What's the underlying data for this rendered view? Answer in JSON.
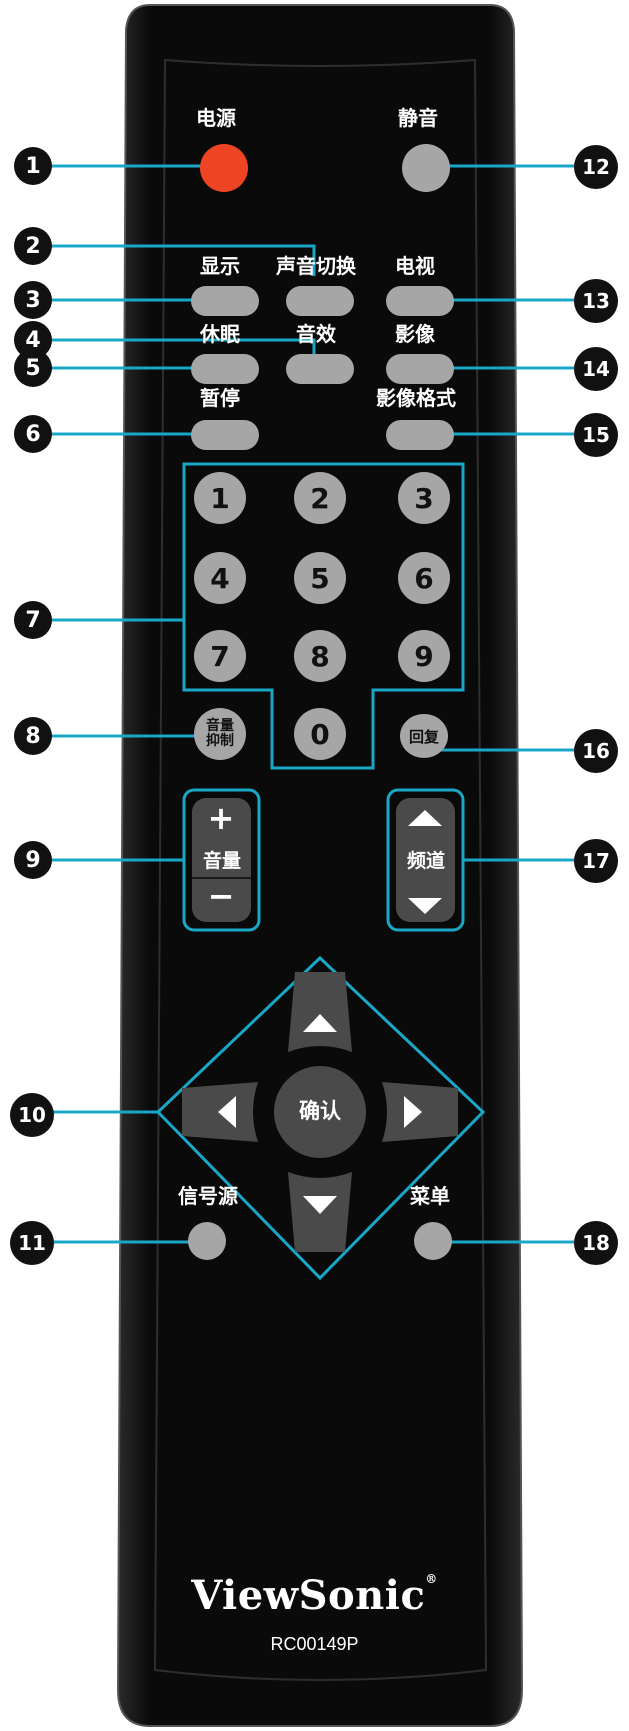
{
  "buttons": {
    "power": "电源",
    "mute": "静音",
    "display": "显示",
    "sound_switch": "声音切换",
    "tv": "电视",
    "sleep": "休眠",
    "sound_effect": "音效",
    "picture": "影像",
    "pause": "暂停",
    "picture_format": "影像格式",
    "volume_suppress_line1": "音量",
    "volume_suppress_line2": "抑制",
    "recall": "回复",
    "volume": "音量",
    "channel": "频道",
    "ok": "确认",
    "source": "信号源",
    "menu": "菜单"
  },
  "keypad": {
    "digits": [
      "1",
      "2",
      "3",
      "4",
      "5",
      "6",
      "7",
      "8",
      "9",
      "0"
    ]
  },
  "volume_symbols": {
    "plus": "+",
    "minus": "−"
  },
  "callouts": [
    "1",
    "2",
    "3",
    "4",
    "5",
    "6",
    "7",
    "8",
    "9",
    "10",
    "11",
    "12",
    "13",
    "14",
    "15",
    "16",
    "17",
    "18"
  ],
  "brand": {
    "name": "ViewSonic",
    "registered": "®",
    "model": "RC00149P"
  },
  "colors": {
    "remote_body": "#0d0d0d",
    "button": "#a6a6a6",
    "power_button": "#ef4423",
    "leader_line": "#19a7c8",
    "dark_key": "#4a4a4a"
  }
}
